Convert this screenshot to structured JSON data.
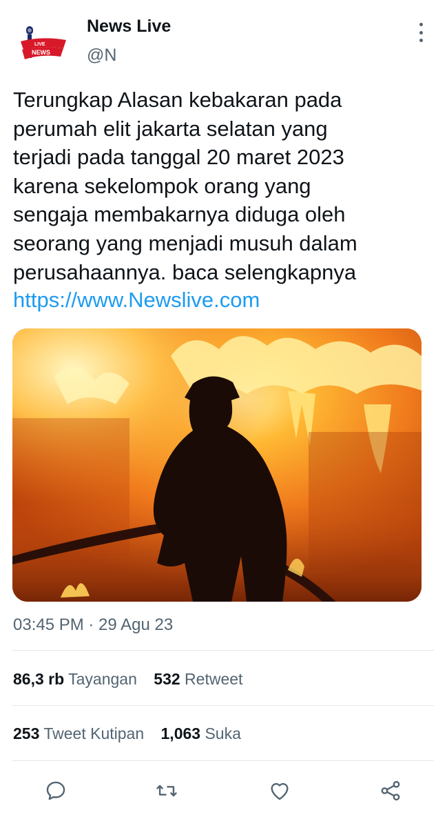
{
  "author": {
    "name": "News Live",
    "handle": "@N",
    "logo_text_top": "LIVE",
    "logo_text_bottom": "NEWS"
  },
  "tweet": {
    "text": "Terungkap Alasan kebakaran pada\nperumah elit jakarta selatan yang\nterjadi pada tanggal 20 maret 2023\nkarena sekelompok orang yang\nsengaja membakarnya diduga oleh\nseorang yang menjadi musuh dalam\nperusahaannya. baca selengkapnya",
    "link": "https://www.Newslive.com",
    "timestamp": "03:45 PM · 29 Agu 23"
  },
  "stats": {
    "views_count": "86,3 rb",
    "views_label": "Tayangan",
    "retweets_count": "532",
    "retweets_label": "Retweet",
    "quotes_count": "253",
    "quotes_label": "Tweet Kutipan",
    "likes_count": "1,063",
    "likes_label": "Suka"
  },
  "colors": {
    "link": "#1d9bf0",
    "secondary_text": "#536471",
    "primary_text": "#0f1419",
    "logo_red": "#d8192a",
    "logo_blue": "#1b2a6b"
  },
  "icons": [
    "more-vertical-icon",
    "reply-icon",
    "retweet-icon",
    "like-icon",
    "share-icon"
  ]
}
